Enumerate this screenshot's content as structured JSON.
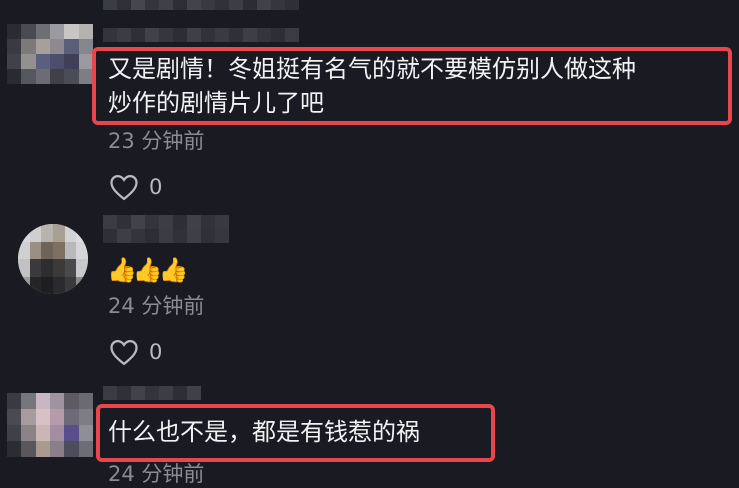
{
  "comments": [
    {
      "text_line1": "又是剧情！冬姐挺有名气的就不要模仿别人做这种",
      "text_line2": "炒作的剧情片儿了吧",
      "time": "23 分钟前",
      "likes": "0"
    },
    {
      "text": "👍👍👍",
      "time": "24 分钟前",
      "likes": "0"
    },
    {
      "text": "什么也不是，都是有钱惹的祸",
      "time": "24 分钟前"
    }
  ],
  "icons": {
    "like": "heart-outline-icon"
  },
  "colors": {
    "background": "#1a1b22",
    "highlight": "#e8454d",
    "text": "#f2f2f4",
    "meta": "#8a8b93"
  }
}
